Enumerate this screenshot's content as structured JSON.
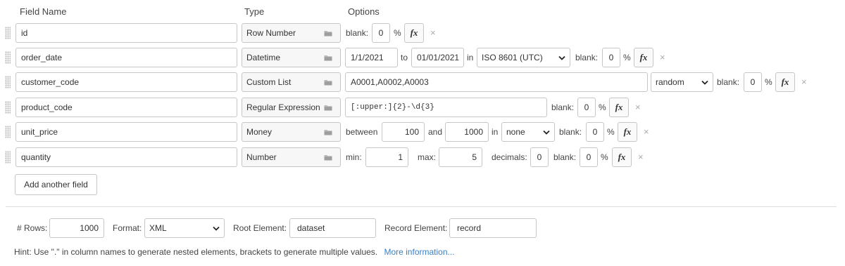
{
  "headers": {
    "field_name": "Field Name",
    "type": "Type",
    "options": "Options"
  },
  "fields": [
    {
      "name": "id",
      "type": "Row Number"
    },
    {
      "name": "order_date",
      "type": "Datetime"
    },
    {
      "name": "customer_code",
      "type": "Custom List"
    },
    {
      "name": "product_code",
      "type": "Regular Expression"
    },
    {
      "name": "unit_price",
      "type": "Money"
    },
    {
      "name": "quantity",
      "type": "Number"
    }
  ],
  "options": {
    "blank_label": "blank:",
    "percent": "%",
    "fx_label": "fx",
    "remove_symbol": "×",
    "id": {
      "blank": "0"
    },
    "order_date": {
      "from": "1/1/2021",
      "to_label": "to",
      "to": "01/01/2021",
      "in_label": "in",
      "timezone": "ISO 8601 (UTC)",
      "blank": "0"
    },
    "customer_code": {
      "values": "A0001,A0002,A0003",
      "mode": "random",
      "blank": "0"
    },
    "product_code": {
      "regex": "[:upper:]{2}-\\d{3}",
      "blank": "0"
    },
    "unit_price": {
      "between_label": "between",
      "min": "100",
      "and_label": "and",
      "max": "1000",
      "in_label": "in",
      "currency": "none",
      "blank": "0"
    },
    "quantity": {
      "min_label": "min:",
      "min": "1",
      "max_label": "max:",
      "max": "5",
      "decimals_label": "decimals:",
      "decimals": "0",
      "blank": "0"
    }
  },
  "add_field_label": "Add another field",
  "footer": {
    "rows_label": "# Rows:",
    "rows": "1000",
    "format_label": "Format:",
    "format": "XML",
    "root_label": "Root Element:",
    "root": "dataset",
    "record_label": "Record Element:",
    "record": "record"
  },
  "hint": {
    "text": "Hint: Use \".\" in column names to generate nested elements, brackets to generate multiple values.",
    "link": "More information..."
  },
  "colors": {
    "link": "#3d7fc1",
    "border": "#c6c6c6",
    "remove": "#aaaaaa"
  }
}
